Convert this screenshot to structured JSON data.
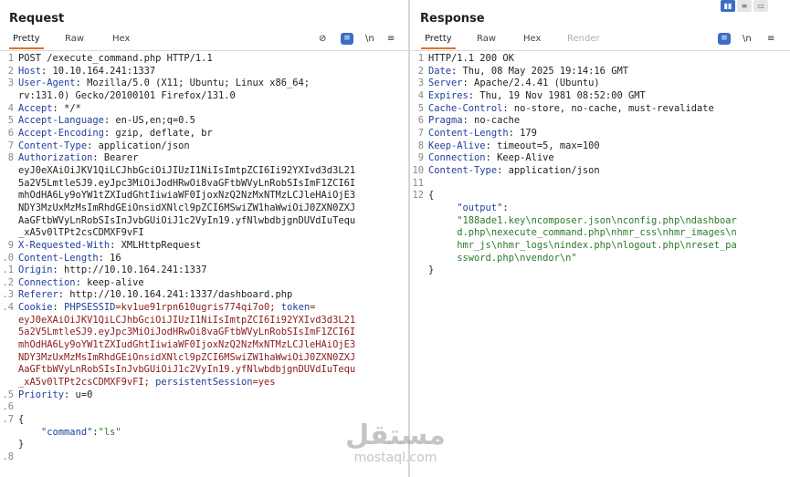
{
  "request": {
    "title": "Request",
    "tabs": [
      "Pretty",
      "Raw",
      "Hex"
    ],
    "icons": [
      "hide-icon",
      "format-icon",
      "newline-icon",
      "menu-icon"
    ],
    "icon_glyphs": [
      "⊘",
      "≡",
      "\\n",
      "≡"
    ],
    "lines": [
      {
        "n": "1",
        "parts": [
          {
            "t": "POST /execute_command.php HTTP/1.1",
            "c": "hv"
          }
        ]
      },
      {
        "n": "2",
        "parts": [
          {
            "t": "Host",
            "c": "hk"
          },
          {
            "t": ": 10.10.164.241:1337",
            "c": "hv"
          }
        ]
      },
      {
        "n": "3",
        "parts": [
          {
            "t": "User-Agent",
            "c": "hk"
          },
          {
            "t": ": Mozilla/5.0 (X11; Ubuntu; Linux x86_64;",
            "c": "hv"
          }
        ]
      },
      {
        "n": "",
        "parts": [
          {
            "t": "rv:131.0) Gecko/20100101 Firefox/131.0",
            "c": "hv"
          }
        ]
      },
      {
        "n": "4",
        "parts": [
          {
            "t": "Accept",
            "c": "hk"
          },
          {
            "t": ": */*",
            "c": "hv"
          }
        ]
      },
      {
        "n": "5",
        "parts": [
          {
            "t": "Accept-Language",
            "c": "hk"
          },
          {
            "t": ": en-US,en;q=0.5",
            "c": "hv"
          }
        ]
      },
      {
        "n": "6",
        "parts": [
          {
            "t": "Accept-Encoding",
            "c": "hk"
          },
          {
            "t": ": gzip, deflate, br",
            "c": "hv"
          }
        ]
      },
      {
        "n": "7",
        "parts": [
          {
            "t": "Content-Type",
            "c": "hk"
          },
          {
            "t": ": application/json",
            "c": "hv"
          }
        ]
      },
      {
        "n": "8",
        "parts": [
          {
            "t": "Authorization",
            "c": "hk"
          },
          {
            "t": ": Bearer",
            "c": "hv"
          }
        ]
      },
      {
        "n": "",
        "parts": [
          {
            "t": "eyJ0eXAiOiJKV1QiLCJhbGciOiJIUzI1NiIsImtpZCI6Ii92YXIvd3d3L21",
            "c": "hv"
          }
        ]
      },
      {
        "n": "",
        "parts": [
          {
            "t": "5a2V5LmtleSJ9.eyJpc3MiOiJodHRwOi8vaGFtbWVyLnRobSIsImF1ZCI6I",
            "c": "hv"
          }
        ]
      },
      {
        "n": "",
        "parts": [
          {
            "t": "mhOdHA6Ly9oYW1tZXIudGhtIiwiaWF0IjoxNzQ2NzMxNTMzLCJleHAiOjE3",
            "c": "hv"
          }
        ]
      },
      {
        "n": "",
        "parts": [
          {
            "t": "NDY3MzUxMzMsImRhdGEiOnsidXNlcl9pZCI6MSwiZW1haWwiOiJ0ZXN0ZXJ",
            "c": "hv"
          }
        ]
      },
      {
        "n": "",
        "parts": [
          {
            "t": "AaGFtbWVyLnRobSIsInJvbGUiOiJ1c2VyIn19.yfNlwbdbjgnDUVdIuTequ",
            "c": "hv"
          }
        ]
      },
      {
        "n": "",
        "parts": [
          {
            "t": "_xA5v0lTPt2csCDMXF9vFI",
            "c": "hv"
          }
        ]
      },
      {
        "n": "9",
        "parts": [
          {
            "t": "X-Requested-With",
            "c": "hk"
          },
          {
            "t": ": XMLHttpRequest",
            "c": "hv"
          }
        ]
      },
      {
        "n": ".0",
        "parts": [
          {
            "t": "Content-Length",
            "c": "hk"
          },
          {
            "t": ": 16",
            "c": "hv"
          }
        ]
      },
      {
        "n": ".1",
        "parts": [
          {
            "t": "Origin",
            "c": "hk"
          },
          {
            "t": ": http://10.10.164.241:1337",
            "c": "hv"
          }
        ]
      },
      {
        "n": ".2",
        "parts": [
          {
            "t": "Connection",
            "c": "hk"
          },
          {
            "t": ": keep-alive",
            "c": "hv"
          }
        ]
      },
      {
        "n": ".3",
        "parts": [
          {
            "t": "Referer",
            "c": "hk"
          },
          {
            "t": ": http://10.10.164.241:1337/dashboard.php",
            "c": "hv"
          }
        ]
      },
      {
        "n": ".4",
        "parts": [
          {
            "t": "Cookie",
            "c": "hk"
          },
          {
            "t": ": ",
            "c": "hv"
          },
          {
            "t": "PHPSESSID",
            "c": "hk"
          },
          {
            "t": "=kv1ue91rpn610ugris774qi7o0; ",
            "c": "ck"
          },
          {
            "t": "token",
            "c": "hk"
          },
          {
            "t": "=",
            "c": "ck"
          }
        ]
      },
      {
        "n": "",
        "parts": [
          {
            "t": "eyJ0eXAiOiJKV1QiLCJhbGciOiJIUzI1NiIsImtpZCI6Ii92YXIvd3d3L21",
            "c": "ck"
          }
        ]
      },
      {
        "n": "",
        "parts": [
          {
            "t": "5a2V5LmtleSJ9.eyJpc3MiOiJodHRwOi8vaGFtbWVyLnRobSIsImF1ZCI6I",
            "c": "ck"
          }
        ]
      },
      {
        "n": "",
        "parts": [
          {
            "t": "mhOdHA6Ly9oYW1tZXIudGhtIiwiaWF0IjoxNzQ2NzMxNTMzLCJleHAiOjE3",
            "c": "ck"
          }
        ]
      },
      {
        "n": "",
        "parts": [
          {
            "t": "NDY3MzUxMzMsImRhdGEiOnsidXNlcl9pZCI6MSwiZW1haWwiOiJ0ZXN0ZXJ",
            "c": "ck"
          }
        ]
      },
      {
        "n": "",
        "parts": [
          {
            "t": "AaGFtbWVyLnRobSIsInJvbGUiOiJ1c2VyIn19.yfNlwbdbjgnDUVdIuTequ",
            "c": "ck"
          }
        ]
      },
      {
        "n": "",
        "parts": [
          {
            "t": "_xA5v0lTPt2csCDMXF9vFI; ",
            "c": "ck"
          },
          {
            "t": "persistentSession",
            "c": "hk"
          },
          {
            "t": "=yes",
            "c": "ck"
          }
        ]
      },
      {
        "n": ".5",
        "parts": [
          {
            "t": "Priority",
            "c": "hk"
          },
          {
            "t": ": u=0",
            "c": "hv"
          }
        ]
      },
      {
        "n": ".6",
        "parts": [
          {
            "t": "",
            "c": "hv"
          }
        ]
      },
      {
        "n": ".7",
        "parts": [
          {
            "t": "{",
            "c": "brace"
          }
        ]
      },
      {
        "n": "",
        "parts": [
          {
            "t": "    ",
            "c": "hv"
          },
          {
            "t": "\"command\"",
            "c": "jk"
          },
          {
            "t": ":",
            "c": "hv"
          },
          {
            "t": "\"ls\"",
            "c": "js"
          }
        ]
      },
      {
        "n": "",
        "parts": [
          {
            "t": "}",
            "c": "brace"
          }
        ]
      },
      {
        "n": ".8",
        "parts": [
          {
            "t": "",
            "c": "hv"
          }
        ]
      }
    ]
  },
  "response": {
    "title": "Response",
    "tabs": [
      "Pretty",
      "Raw",
      "Hex",
      "Render"
    ],
    "icons": [
      "format-icon",
      "newline-icon",
      "menu-icon"
    ],
    "icon_glyphs": [
      "≡",
      "\\n",
      "≡"
    ],
    "view_toggles": [
      "▮▮",
      "≡",
      "▭"
    ],
    "lines": [
      {
        "n": "1",
        "parts": [
          {
            "t": "HTTP/1.1 200 OK",
            "c": "hv"
          }
        ]
      },
      {
        "n": "2",
        "parts": [
          {
            "t": "Date",
            "c": "hk"
          },
          {
            "t": ": Thu, 08 May 2025 19:14:16 GMT",
            "c": "hv"
          }
        ]
      },
      {
        "n": "3",
        "parts": [
          {
            "t": "Server",
            "c": "hk"
          },
          {
            "t": ": Apache/2.4.41 (Ubuntu)",
            "c": "hv"
          }
        ]
      },
      {
        "n": "4",
        "parts": [
          {
            "t": "Expires",
            "c": "hk"
          },
          {
            "t": ": Thu, 19 Nov 1981 08:52:00 GMT",
            "c": "hv"
          }
        ]
      },
      {
        "n": "5",
        "parts": [
          {
            "t": "Cache-Control",
            "c": "hk"
          },
          {
            "t": ": no-store, no-cache, must-revalidate",
            "c": "hv"
          }
        ]
      },
      {
        "n": "6",
        "parts": [
          {
            "t": "Pragma",
            "c": "hk"
          },
          {
            "t": ": no-cache",
            "c": "hv"
          }
        ]
      },
      {
        "n": "7",
        "parts": [
          {
            "t": "Content-Length",
            "c": "hk"
          },
          {
            "t": ": 179",
            "c": "hv"
          }
        ]
      },
      {
        "n": "8",
        "parts": [
          {
            "t": "Keep-Alive",
            "c": "hk"
          },
          {
            "t": ": timeout=5, max=100",
            "c": "hv"
          }
        ]
      },
      {
        "n": "9",
        "parts": [
          {
            "t": "Connection",
            "c": "hk"
          },
          {
            "t": ": Keep-Alive",
            "c": "hv"
          }
        ]
      },
      {
        "n": "10",
        "parts": [
          {
            "t": "Content-Type",
            "c": "hk"
          },
          {
            "t": ": application/json",
            "c": "hv"
          }
        ]
      },
      {
        "n": "11",
        "parts": [
          {
            "t": "",
            "c": "hv"
          }
        ]
      },
      {
        "n": "12",
        "parts": [
          {
            "t": "{",
            "c": "brace"
          }
        ]
      },
      {
        "n": "",
        "parts": [
          {
            "t": "     ",
            "c": "hv"
          },
          {
            "t": "\"output\"",
            "c": "jk"
          },
          {
            "t": ":",
            "c": "hv"
          }
        ]
      },
      {
        "n": "",
        "parts": [
          {
            "t": "     ",
            "c": "hv"
          },
          {
            "t": "\"188ade1.key\\ncomposer.json\\nconfig.php\\ndashboar",
            "c": "js"
          }
        ]
      },
      {
        "n": "",
        "parts": [
          {
            "t": "     ",
            "c": "hv"
          },
          {
            "t": "d.php\\nexecute_command.php\\nhmr_css\\nhmr_images\\n",
            "c": "js"
          }
        ]
      },
      {
        "n": "",
        "parts": [
          {
            "t": "     ",
            "c": "hv"
          },
          {
            "t": "hmr_js\\nhmr_logs\\nindex.php\\nlogout.php\\nreset_pa",
            "c": "js"
          }
        ]
      },
      {
        "n": "",
        "parts": [
          {
            "t": "     ",
            "c": "hv"
          },
          {
            "t": "ssword.php\\nvendor\\n\"",
            "c": "js"
          }
        ]
      },
      {
        "n": "",
        "parts": [
          {
            "t": "}",
            "c": "brace"
          }
        ]
      }
    ]
  },
  "watermark": {
    "arabic": "مستقل",
    "latin": "mostaql.com"
  }
}
